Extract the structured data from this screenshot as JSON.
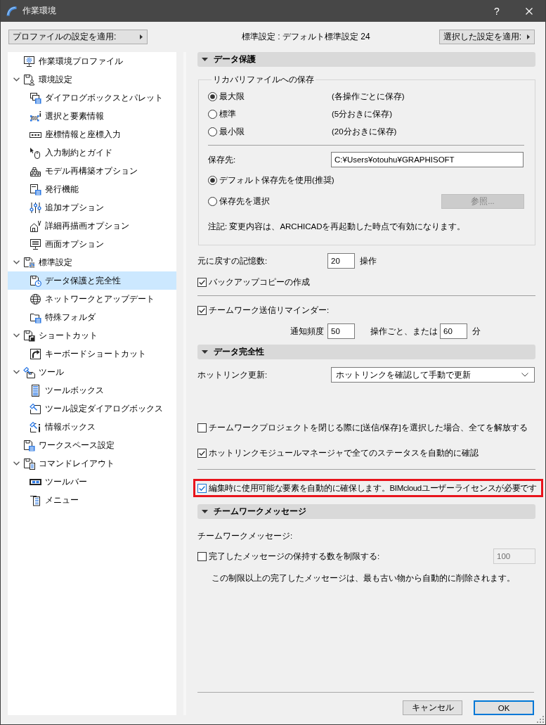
{
  "window": {
    "title": "作業環境",
    "help": "?"
  },
  "toolbar": {
    "profile_button": "プロファイルの設定を適用:",
    "current_profile": "標準設定 : デフォルト標準設定 24",
    "apply_button": "選択した設定を適用:"
  },
  "sidebar": {
    "items": [
      {
        "label": "作業環境プロファイル",
        "selected": false
      },
      {
        "label": "環境設定",
        "selected": false,
        "expanded": true,
        "children": [
          {
            "label": "ダイアログボックスとパレット",
            "selected": false
          },
          {
            "label": "選択と要素情報",
            "selected": false
          },
          {
            "label": "座標情報と座標入力",
            "selected": false
          },
          {
            "label": "入力制約とガイド",
            "selected": false
          },
          {
            "label": "モデル再構築オプション",
            "selected": false
          },
          {
            "label": "発行機能",
            "selected": false
          },
          {
            "label": "追加オプション",
            "selected": false
          },
          {
            "label": "詳細再描画オプション",
            "selected": false
          },
          {
            "label": "画面オプション",
            "selected": false
          }
        ]
      },
      {
        "label": "標準設定",
        "selected": false,
        "expanded": true,
        "children": [
          {
            "label": "データ保護と完全性",
            "selected": true
          },
          {
            "label": "ネットワークとアップデート",
            "selected": false
          },
          {
            "label": "特殊フォルダ",
            "selected": false
          }
        ]
      },
      {
        "label": "ショートカット",
        "selected": false,
        "expanded": true,
        "children": [
          {
            "label": "キーボードショートカット",
            "selected": false
          }
        ]
      },
      {
        "label": "ツール",
        "selected": false,
        "expanded": true,
        "children": [
          {
            "label": "ツールボックス",
            "selected": false
          },
          {
            "label": "ツール設定ダイアログボックス",
            "selected": false
          },
          {
            "label": "情報ボックス",
            "selected": false
          }
        ]
      },
      {
        "label": "ワークスペース設定",
        "selected": false
      },
      {
        "label": "コマンドレイアウト",
        "selected": false,
        "expanded": true,
        "children": [
          {
            "label": "ツールバー",
            "selected": false
          },
          {
            "label": "メニュー",
            "selected": false
          }
        ]
      }
    ]
  },
  "data_protection": {
    "title": "データ保護",
    "expanded": true,
    "recovery": {
      "title": "リカバリファイルへの保存",
      "levels": [
        {
          "label": "最大限",
          "hint": "(各操作ごとに保存)",
          "selected": true
        },
        {
          "label": "標準",
          "hint": "(5分おきに保存)",
          "selected": false
        },
        {
          "label": "最小限",
          "hint": "(20分おきに保存)",
          "selected": false
        }
      ],
      "location_label": "保存先:",
      "location": "C:¥Users¥otouhu¥GRAPHISOFT",
      "location_options": [
        {
          "label": "デフォルト保存先を使用(推奨)",
          "selected": true
        },
        {
          "label": "保存先を選択",
          "selected": false
        }
      ],
      "browse_button": {
        "label": "参照...",
        "disabled": true
      },
      "note": "注記: 変更内容は、ARCHICADを再起動した時点で有効になります。"
    },
    "undo": {
      "label": "元に戻すの記憶数:",
      "value": "20",
      "unit": "操作"
    },
    "backup": {
      "label": "バックアップコピーの作成",
      "checked": true
    },
    "reminder": {
      "label": "チームワーク送信リマインダー:",
      "checked": true,
      "frequency_label": "通知頻度",
      "operations": "50",
      "operations_unit": "操作ごと、または",
      "minutes": "60",
      "minutes_unit": "分"
    }
  },
  "data_integrity": {
    "title": "データ完全性",
    "expanded": true,
    "hotlink_label": "ホットリンク更新:",
    "hotlink_update": "ホットリンクを確認して手動で更新",
    "options": [
      {
        "label": "チームワークプロジェクトを閉じる際に[送信/保存]を選択した場合、全てを解放する",
        "checked": false
      },
      {
        "label": "ホットリンクモジュールマネージャで全てのステータスを自動的に確認",
        "checked": true
      }
    ],
    "auto_reserve": {
      "label": "編集時に使用可能な要素を自動的に確保します。BIMcloudユーザーライセンスが必要です",
      "checked": true,
      "highlighted": true
    }
  },
  "teamwork_messages": {
    "title": "チームワークメッセージ",
    "expanded": true,
    "label": "チームワークメッセージ:",
    "limit": {
      "label": "完了したメッセージの保持する数を制限する:",
      "checked": false,
      "value": "100",
      "disabled": true
    },
    "note": "この制限以上の完了したメッセージは、最も古い物から自動的に削除されます。"
  },
  "footer": {
    "buttons": [
      {
        "label": "キャンセル",
        "default": false
      },
      {
        "label": "OK",
        "default": true
      }
    ]
  }
}
